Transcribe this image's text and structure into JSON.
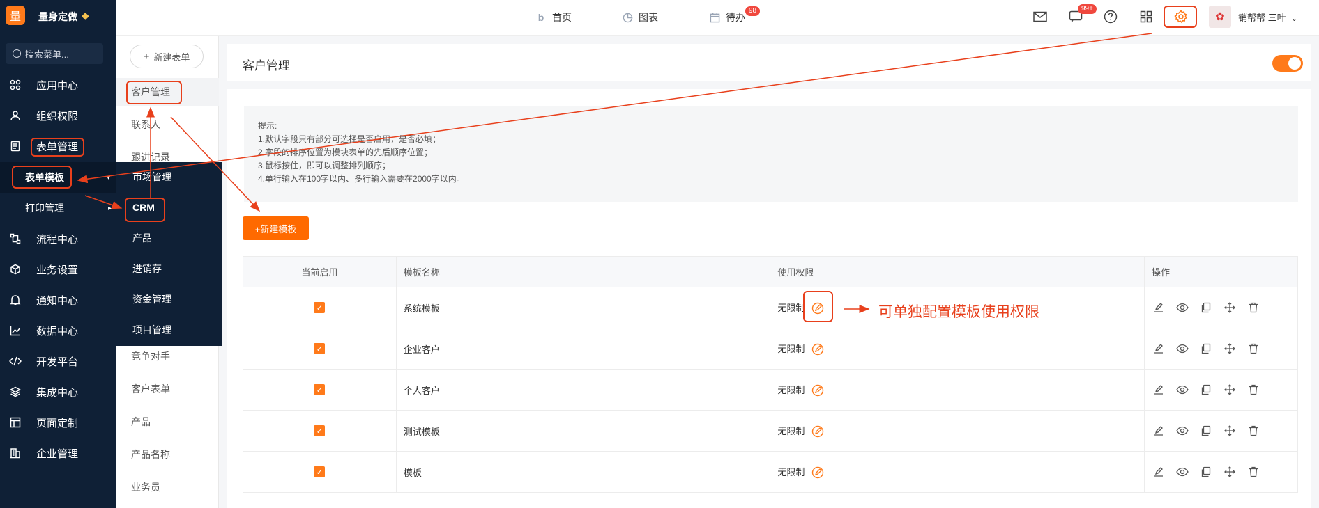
{
  "sidebar": {
    "logo_char": "量",
    "brand": "量身定做",
    "search_placeholder": "搜索菜单...",
    "items": [
      {
        "label": "应用中心",
        "icon": "apps-icon"
      },
      {
        "label": "组织权限",
        "icon": "user-icon"
      },
      {
        "label": "表单管理",
        "icon": "form-icon"
      },
      {
        "label": "流程中心",
        "icon": "flow-icon"
      },
      {
        "label": "业务设置",
        "icon": "box-icon"
      },
      {
        "label": "通知中心",
        "icon": "bell-icon"
      },
      {
        "label": "数据中心",
        "icon": "chart-icon"
      },
      {
        "label": "开发平台",
        "icon": "code-icon"
      },
      {
        "label": "集成中心",
        "icon": "layers-icon"
      },
      {
        "label": "页面定制",
        "icon": "layout-icon"
      },
      {
        "label": "企业管理",
        "icon": "building-icon"
      }
    ],
    "sub_items": [
      "表单模板",
      "打印管理"
    ]
  },
  "panel2": {
    "new_form_label": "新建表单",
    "items": [
      "客户管理",
      "联系人",
      "跟进记录",
      "竞争对手",
      "客户表单",
      "产品",
      "产品名称",
      "业务员"
    ],
    "dark_items": [
      "市场管理",
      "CRM",
      "产品",
      "进销存",
      "资金管理",
      "项目管理"
    ]
  },
  "topbar": {
    "nav": [
      {
        "label": "首页",
        "icon": "home-icon"
      },
      {
        "label": "图表",
        "icon": "pie-icon"
      },
      {
        "label": "待办",
        "icon": "calendar-icon",
        "badge": "98"
      }
    ],
    "chat_badge": "99+",
    "user_name": "销帮帮 三叶"
  },
  "main": {
    "title": "客户管理",
    "toggle_on": true,
    "tips": [
      "提示:",
      "1.默认字段只有部分可选择是否启用，是否必填；",
      "2.字段的排序位置为模块表单的先后顺序位置；",
      "3.鼠标按住，即可以调整排列顺序；",
      "4.单行输入在100字以内、多行输入需要在2000字以内。"
    ],
    "new_template_label": "+新建模板",
    "table": {
      "headers": [
        "当前启用",
        "模板名称",
        "使用权限",
        "操作"
      ],
      "rows": [
        {
          "enabled": true,
          "name": "系统模板",
          "permission": "无限制"
        },
        {
          "enabled": true,
          "name": "企业客户",
          "permission": "无限制"
        },
        {
          "enabled": true,
          "name": "个人客户",
          "permission": "无限制"
        },
        {
          "enabled": true,
          "name": "测试模板",
          "permission": "无限制"
        },
        {
          "enabled": true,
          "name": "模板",
          "permission": "无限制"
        }
      ]
    }
  },
  "annotation": {
    "text": "可单独配置模板使用权限",
    "color": "#e8401c"
  },
  "colors": {
    "accent": "#ff7a1a",
    "sidebar_bg": "#0f2036",
    "annotation": "#e8401c"
  }
}
